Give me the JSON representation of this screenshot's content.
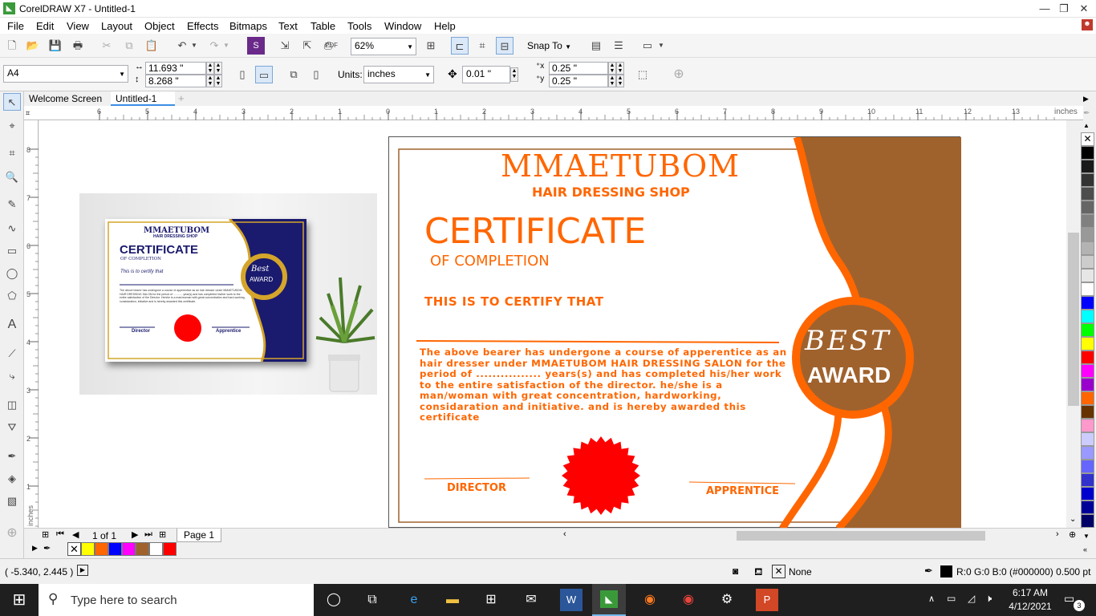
{
  "window": {
    "title": "CorelDRAW X7 - Untitled-1"
  },
  "menu": [
    "File",
    "Edit",
    "View",
    "Layout",
    "Object",
    "Effects",
    "Bitmaps",
    "Text",
    "Table",
    "Tools",
    "Window",
    "Help"
  ],
  "toolbar": {
    "zoom": "62%",
    "snap_label": "Snap To"
  },
  "property_bar": {
    "page_size": "A4",
    "width": "11.693 \"",
    "height": "8.268 \"",
    "units_label": "Units:",
    "units": "inches",
    "nudge": "0.01 \"",
    "dup_x": "0.25 \"",
    "dup_y": "0.25 \""
  },
  "tabs": [
    "Welcome Screen",
    "Untitled-1"
  ],
  "ruler": {
    "h_ticks": [
      "6",
      "5",
      "4",
      "3",
      "2",
      "1",
      "0",
      "1",
      "2",
      "3",
      "4",
      "5",
      "6",
      "7",
      "8",
      "9",
      "10",
      "11",
      "12",
      "13"
    ],
    "unit": "inches",
    "v_ticks": [
      "8",
      "7",
      "6",
      "5",
      "4",
      "3",
      "2",
      "1"
    ],
    "v_unit": "inches"
  },
  "certificate": {
    "shop": "MMAETUBOM",
    "subtitle": "HAIR DRESSING SHOP",
    "title": "CERTIFICATE",
    "of_completion": "OF COMPLETION",
    "certify": "THIS IS TO CERTIFY THAT",
    "body": "The above bearer has undergone a course of apperentice as an hair dresser under MMAETUBOM HAIR DRESSING SALON for the period of ................ years(s) and has completed his/her work to the entire satisfaction of the director. he/she is a man/woman with great concentration, hardworking, considaration and initiative. and is hereby awarded this certificate",
    "best": "BEST",
    "award": "AWARD",
    "director": "DIRECTOR",
    "apprentice": "APPRENTICE"
  },
  "preview": {
    "shop": "MMAETUBOM",
    "subtitle": "HAIR DRESSING SHOP",
    "title": "CERTIFICATE",
    "of_completion": "OF COMPLETION",
    "certify": "This is to certify that",
    "body": "The above bearer has undergone a course of apperentice as an hair dresser under MMAETUBOM HAIR DRESSING SALON for the period of ............ year(s) and has completed his/her work to the entire satisfaction of the Director. He/she is a man/woman with great concentration and hard-working, considaration, initiative and is hereby awarded this certificate.",
    "best": "Best",
    "award": "AWARD",
    "director": "Director",
    "apprentice": "Apprentice"
  },
  "page_nav": {
    "counter": "1 of 1",
    "page_tab": "Page 1"
  },
  "status": {
    "coords": "( -5.340, 2.445  )",
    "fill": "None",
    "outline": "R:0 G:0 B:0 (#000000)  0.500 pt"
  },
  "taskbar": {
    "search": "Type here to search",
    "time": "6:17 AM",
    "date": "4/12/2021",
    "notif": "3"
  },
  "colors": {
    "orange": "#ff6600",
    "brown": "#a0622d",
    "navy": "#1a1a6e",
    "red": "#ff0000"
  },
  "palette": [
    "#ffffff",
    "#000000",
    "#1a1a1a",
    "#333333",
    "#4d4d4d",
    "#666666",
    "#808080",
    "#999999",
    "#b3b3b3",
    "#cccccc",
    "#e6e6e6",
    "#ffffff",
    "#0000ff",
    "#00ffff",
    "#00ff00",
    "#ffff00",
    "#ff0000",
    "#ff00ff",
    "#9900cc",
    "#ff6600",
    "#663300",
    "#ff99cc",
    "#ccccff",
    "#9999ff",
    "#6666ff",
    "#3333cc",
    "#0000cc",
    "#000099",
    "#000066"
  ],
  "doc_palette": [
    "#ffff00",
    "#ff6600",
    "#0000ff",
    "#ff00ff",
    "#a0622d",
    "#ffffff",
    "#ff0000"
  ]
}
